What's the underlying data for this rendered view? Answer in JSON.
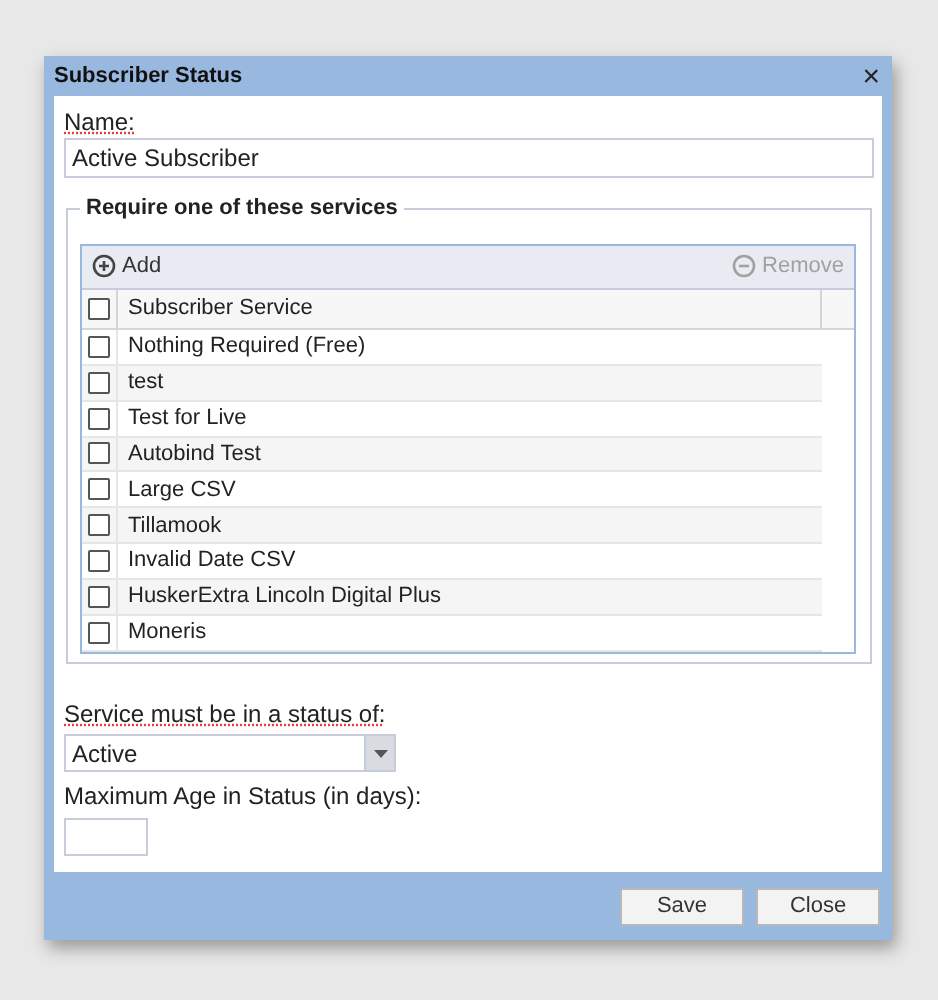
{
  "window": {
    "title": "Subscriber Status",
    "close": "×"
  },
  "name_field": {
    "label": "Name:",
    "value": "Active Subscriber"
  },
  "services": {
    "legend": "Require one of these services",
    "add": "Add",
    "remove": "Remove",
    "remove_disabled": true,
    "header": {
      "label": "Subscriber Service",
      "checked": false
    },
    "rows": [
      {
        "label": "Nothing Required (Free)",
        "checked": false
      },
      {
        "label": "test",
        "checked": false
      },
      {
        "label": "Test for Live",
        "checked": false
      },
      {
        "label": "Autobind Test",
        "checked": false
      },
      {
        "label": "Large CSV",
        "checked": false
      },
      {
        "label": "Tillamook",
        "checked": false
      },
      {
        "label": "Invalid Date CSV",
        "checked": false
      },
      {
        "label": "HuskerExtra Lincoln Digital Plus",
        "checked": false
      },
      {
        "label": "Moneris",
        "checked": false
      }
    ]
  },
  "status_field": {
    "label": "Service must be in a status of:",
    "value": "Active"
  },
  "age_field": {
    "label": "Maximum Age in Status (in days):"
  },
  "buttons": [
    "Save",
    "Close"
  ]
}
